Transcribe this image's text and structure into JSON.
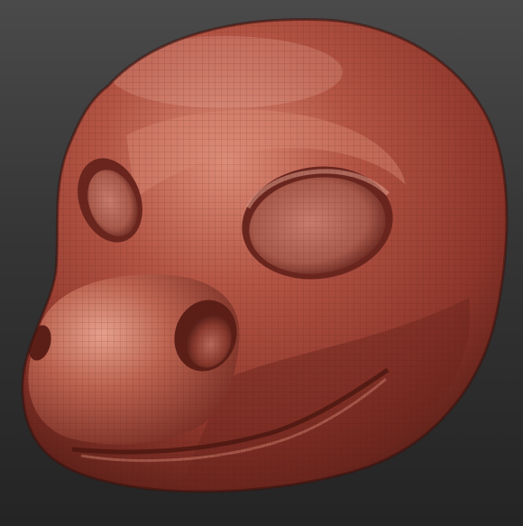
{
  "viewport": {
    "object": "sculpted-creature-head",
    "material": "red-wax-matcap",
    "wireframe_visible": true,
    "colors": {
      "background_top": "#4a4a4a",
      "background_bottom": "#242424",
      "material_base": "#a4473a",
      "material_highlight": "#e39a86",
      "material_shadow": "#5a1f18",
      "wireframe": "#6b2a22"
    }
  }
}
